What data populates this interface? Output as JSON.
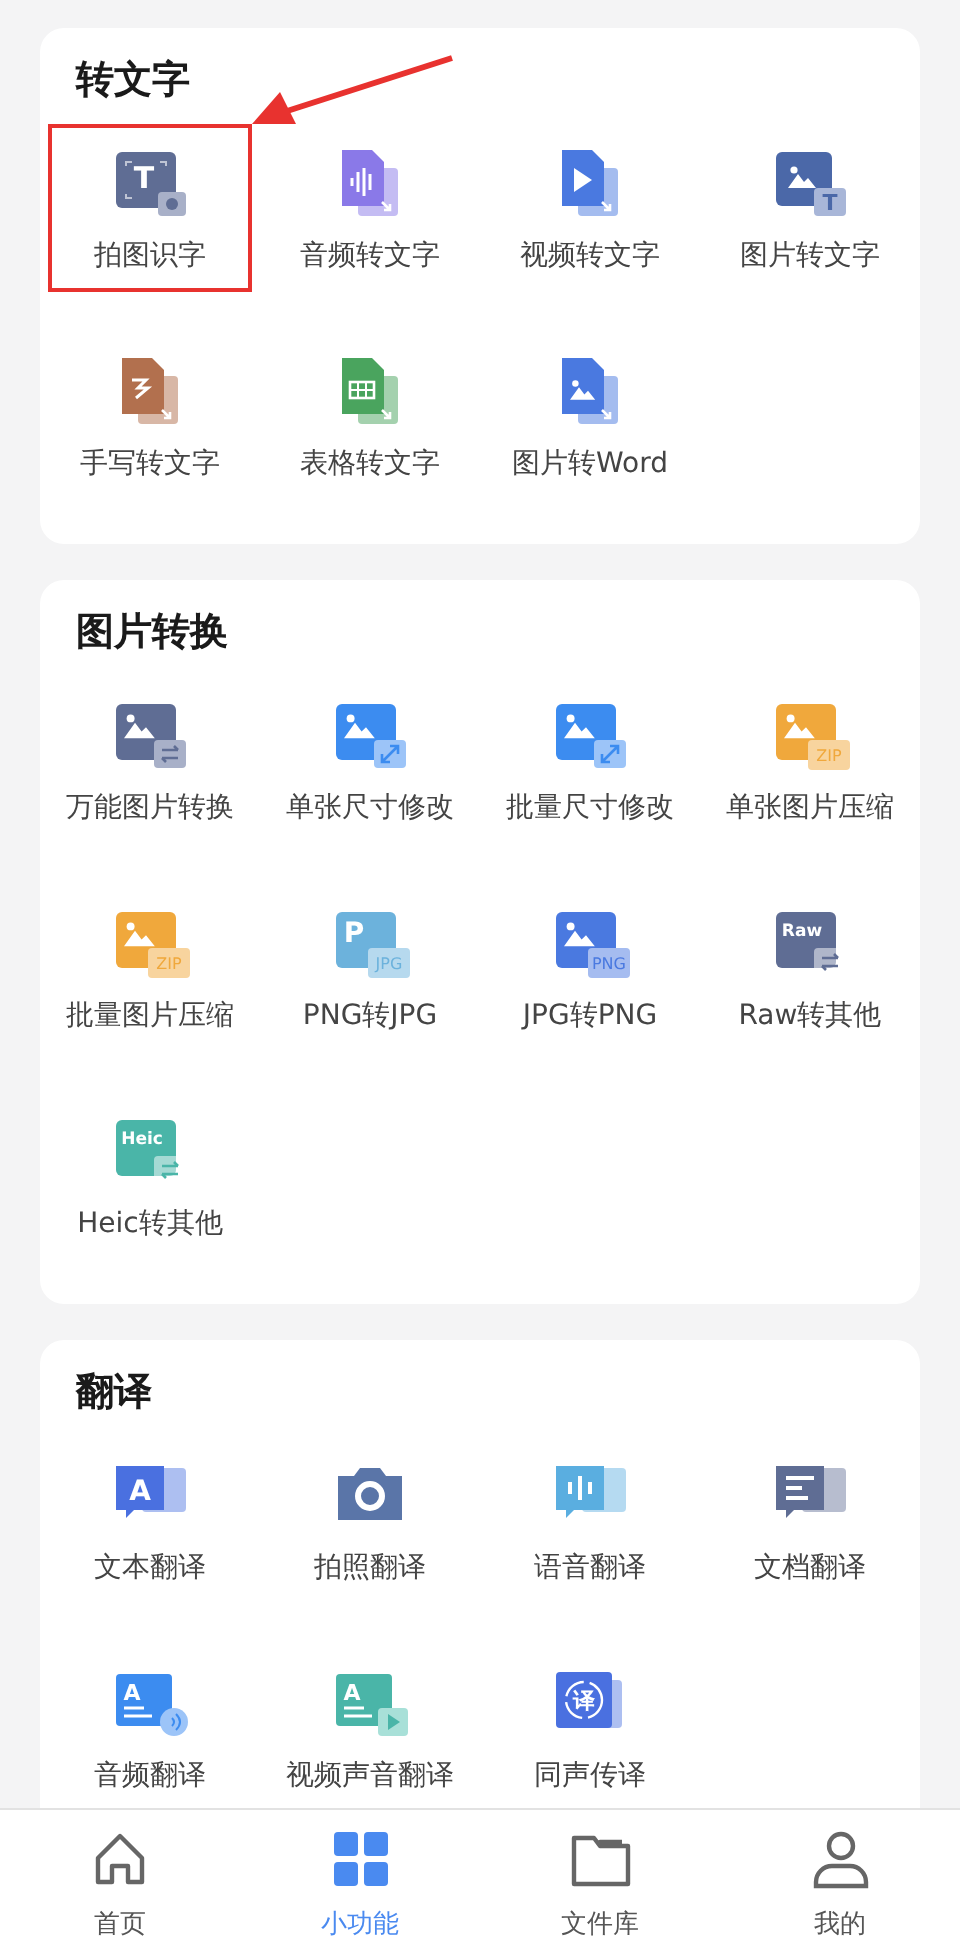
{
  "sections": [
    {
      "title": "转文字",
      "items": [
        {
          "label": "拍图识字",
          "kind": "scan-text",
          "color": "#5f6d94",
          "mark": "T",
          "highlighted": true
        },
        {
          "label": "音频转文字",
          "kind": "doc-audio",
          "color": "#8a79e8",
          "highlighted": false
        },
        {
          "label": "视频转文字",
          "kind": "doc-video",
          "color": "#4a79e0",
          "highlighted": false
        },
        {
          "label": "图片转文字",
          "kind": "photo-text",
          "color": "#4b68a8",
          "badge": "T",
          "highlighted": false
        },
        {
          "label": "手写转文字",
          "kind": "doc-hand",
          "color": "#b2704e",
          "highlighted": false
        },
        {
          "label": "表格转文字",
          "kind": "doc-table",
          "color": "#4aa45e",
          "highlighted": false
        },
        {
          "label": "图片转Word",
          "kind": "doc-image",
          "color": "#4a79e0",
          "highlighted": false
        }
      ]
    },
    {
      "title": "图片转换",
      "items": [
        {
          "label": "万能图片转换",
          "kind": "image-swap",
          "color": "#5f6d94",
          "highlighted": false
        },
        {
          "label": "单张尺寸修改",
          "kind": "image-resize",
          "color": "#3c8cf0",
          "highlighted": false
        },
        {
          "label": "批量尺寸修改",
          "kind": "image-resize",
          "color": "#3c8cf0",
          "highlighted": false
        },
        {
          "label": "单张图片压缩",
          "kind": "image-badge",
          "color": "#f0a83c",
          "badge": "ZIP",
          "highlighted": false
        },
        {
          "label": "批量图片压缩",
          "kind": "image-badge",
          "color": "#f0a83c",
          "badge": "ZIP",
          "highlighted": false
        },
        {
          "label": "PNG转JPG",
          "kind": "letter-badge",
          "color": "#6cb2dc",
          "mark": "P",
          "badge": "JPG",
          "highlighted": false
        },
        {
          "label": "JPG转PNG",
          "kind": "image-badge",
          "color": "#4a79e0",
          "badge": "PNG",
          "highlighted": false
        },
        {
          "label": "Raw转其他",
          "kind": "text-swap",
          "color": "#5f6d94",
          "mark": "Raw",
          "highlighted": false
        },
        {
          "label": "Heic转其他",
          "kind": "text-swap",
          "color": "#4ab5a8",
          "mark": "Heic",
          "highlighted": false
        }
      ]
    },
    {
      "title": "翻译",
      "items": [
        {
          "label": "文本翻译",
          "kind": "bubble-letter",
          "color": "#4a70e0",
          "mark": "A",
          "highlighted": false
        },
        {
          "label": "拍照翻译",
          "kind": "camera",
          "color": "#5a75a8",
          "highlighted": false
        },
        {
          "label": "语音翻译",
          "kind": "bubble-voice",
          "color": "#5aaee0",
          "highlighted": false
        },
        {
          "label": "文档翻译",
          "kind": "bubble-doc",
          "color": "#5f6d94",
          "highlighted": false
        },
        {
          "label": "音频翻译",
          "kind": "letter-sound",
          "color": "#3c8cf0",
          "mark": "A",
          "highlighted": false
        },
        {
          "label": "视频声音翻译",
          "kind": "letter-play",
          "color": "#4ab5a8",
          "mark": "A",
          "highlighted": false
        },
        {
          "label": "同声传译",
          "kind": "circle-char",
          "color": "#4a70e0",
          "mark": "译",
          "highlighted": false
        }
      ]
    }
  ],
  "tabs": [
    {
      "label": "首页",
      "kind": "home",
      "selected": false
    },
    {
      "label": "小功能",
      "kind": "grid",
      "selected": true
    },
    {
      "label": "文件库",
      "kind": "folder",
      "selected": false
    },
    {
      "label": "我的",
      "kind": "person",
      "selected": false
    }
  ]
}
